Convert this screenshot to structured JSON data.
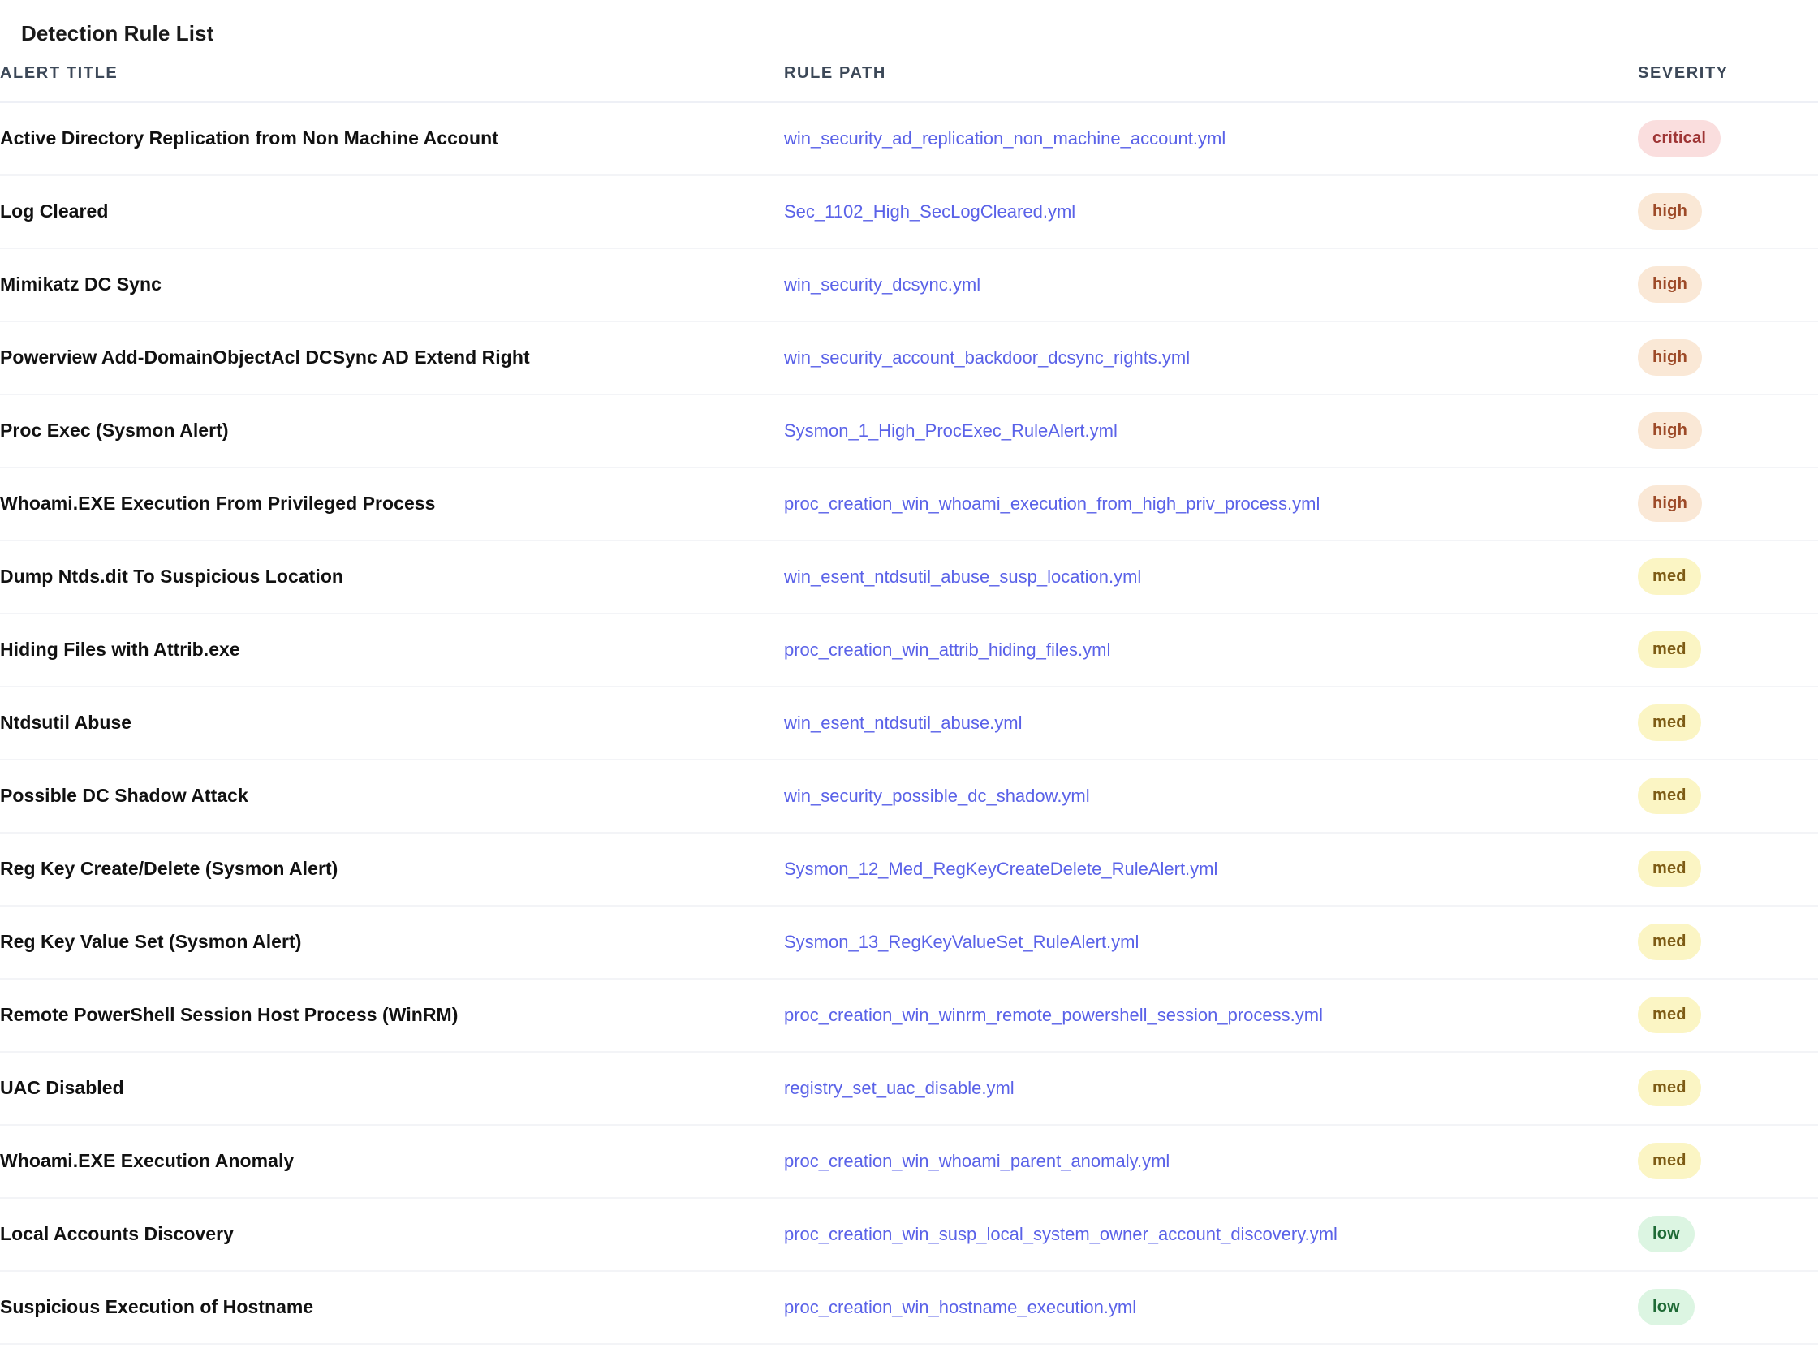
{
  "page": {
    "title": "Detection Rule List"
  },
  "table": {
    "columns": [
      {
        "key": "alert_title",
        "label": "ALERT TITLE"
      },
      {
        "key": "rule_path",
        "label": "RULE PATH"
      },
      {
        "key": "severity",
        "label": "SEVERITY"
      }
    ],
    "severity_colors": {
      "critical": {
        "bg": "#fadede",
        "fg": "#9e3535"
      },
      "high": {
        "bg": "#fae8d6",
        "fg": "#9d4a28"
      },
      "med": {
        "bg": "#fbf5c4",
        "fg": "#7d5b15"
      },
      "low": {
        "bg": "#dcf5e2",
        "fg": "#1f6b36"
      }
    },
    "link_color": "#5a62e8",
    "rows": [
      {
        "alert_title": "Active Directory Replication from Non Machine Account",
        "rule_path": "win_security_ad_replication_non_machine_account.yml",
        "severity": "critical"
      },
      {
        "alert_title": "Log Cleared",
        "rule_path": "Sec_1102_High_SecLogCleared.yml",
        "severity": "high"
      },
      {
        "alert_title": "Mimikatz DC Sync",
        "rule_path": "win_security_dcsync.yml",
        "severity": "high"
      },
      {
        "alert_title": "Powerview Add-DomainObjectAcl DCSync AD Extend Right",
        "rule_path": "win_security_account_backdoor_dcsync_rights.yml",
        "severity": "high"
      },
      {
        "alert_title": "Proc Exec (Sysmon Alert)",
        "rule_path": "Sysmon_1_High_ProcExec_RuleAlert.yml",
        "severity": "high"
      },
      {
        "alert_title": "Whoami.EXE Execution From Privileged Process",
        "rule_path": "proc_creation_win_whoami_execution_from_high_priv_process.yml",
        "severity": "high"
      },
      {
        "alert_title": "Dump Ntds.dit To Suspicious Location",
        "rule_path": "win_esent_ntdsutil_abuse_susp_location.yml",
        "severity": "med"
      },
      {
        "alert_title": "Hiding Files with Attrib.exe",
        "rule_path": "proc_creation_win_attrib_hiding_files.yml",
        "severity": "med"
      },
      {
        "alert_title": "Ntdsutil Abuse",
        "rule_path": "win_esent_ntdsutil_abuse.yml",
        "severity": "med"
      },
      {
        "alert_title": "Possible DC Shadow Attack",
        "rule_path": "win_security_possible_dc_shadow.yml",
        "severity": "med"
      },
      {
        "alert_title": "Reg Key Create/Delete (Sysmon Alert)",
        "rule_path": "Sysmon_12_Med_RegKeyCreateDelete_RuleAlert.yml",
        "severity": "med"
      },
      {
        "alert_title": "Reg Key Value Set (Sysmon Alert)",
        "rule_path": "Sysmon_13_RegKeyValueSet_RuleAlert.yml",
        "severity": "med"
      },
      {
        "alert_title": "Remote PowerShell Session Host Process (WinRM)",
        "rule_path": "proc_creation_win_winrm_remote_powershell_session_process.yml",
        "severity": "med"
      },
      {
        "alert_title": "UAC Disabled",
        "rule_path": "registry_set_uac_disable.yml",
        "severity": "med"
      },
      {
        "alert_title": "Whoami.EXE Execution Anomaly",
        "rule_path": "proc_creation_win_whoami_parent_anomaly.yml",
        "severity": "med"
      },
      {
        "alert_title": "Local Accounts Discovery",
        "rule_path": "proc_creation_win_susp_local_system_owner_account_discovery.yml",
        "severity": "low"
      },
      {
        "alert_title": "Suspicious Execution of Hostname",
        "rule_path": "proc_creation_win_hostname_execution.yml",
        "severity": "low"
      }
    ]
  }
}
